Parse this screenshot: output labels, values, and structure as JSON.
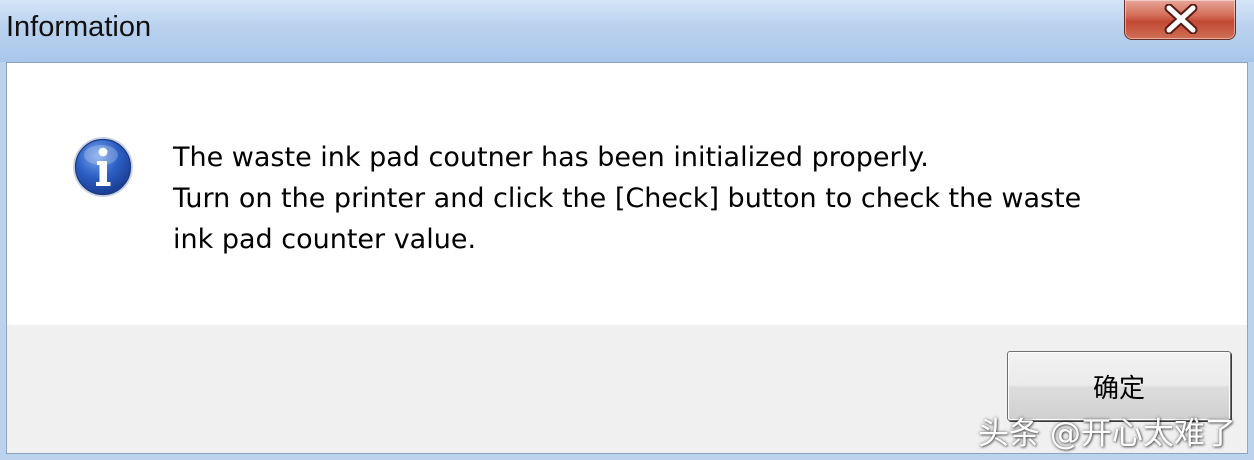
{
  "window": {
    "title": "Information",
    "close_icon": "close-icon"
  },
  "dialog": {
    "icon": "info-icon",
    "message_lines": [
      "The waste ink pad coutner has been initialized properly.",
      "Turn on the printer and click the [Check] button to check the waste",
      "ink pad counter value."
    ],
    "ok_label": "确定"
  },
  "watermark": {
    "text": "头条 @开心太难了"
  },
  "colors": {
    "titlebar": "#b9d1ee",
    "close_button": "#c24a35",
    "info_icon": "#2a57b8"
  }
}
